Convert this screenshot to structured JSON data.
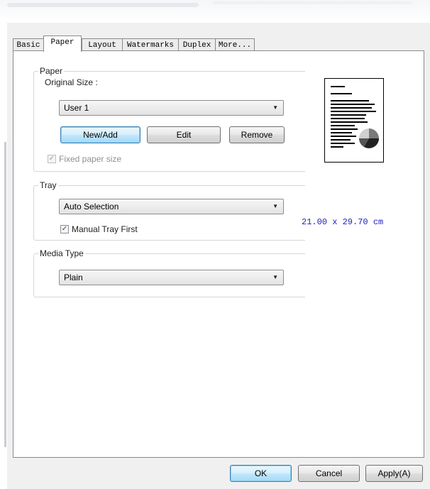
{
  "tabs": [
    {
      "label": "Basic",
      "active": false
    },
    {
      "label": "Paper",
      "active": true
    },
    {
      "label": "Layout",
      "active": false
    },
    {
      "label": "Watermarks",
      "active": false
    },
    {
      "label": "Duplex",
      "active": false
    },
    {
      "label": "More...",
      "active": false
    }
  ],
  "paper_group": {
    "legend": "Paper",
    "original_size_label": "Original Size :",
    "original_size_value": "User 1",
    "buttons": {
      "new_add": "New/Add",
      "edit": "Edit",
      "remove": "Remove"
    },
    "fixed_paper_size": {
      "label": "Fixed paper size",
      "checked": true,
      "enabled": false
    }
  },
  "tray_group": {
    "legend": "Tray",
    "tray_value": "Auto Selection",
    "manual_tray_first": {
      "label": "Manual Tray First",
      "checked": true
    }
  },
  "media_group": {
    "legend": "Media Type",
    "media_value": "Plain"
  },
  "preview": {
    "dimensions": "21.00 x 29.70 cm",
    "icon": "page-preview-icon"
  },
  "footer": {
    "ok": "OK",
    "cancel": "Cancel",
    "apply": "Apply(A)"
  },
  "colors": {
    "dimension_text": "#2020c0",
    "default_button_border": "#3c7fb1"
  }
}
